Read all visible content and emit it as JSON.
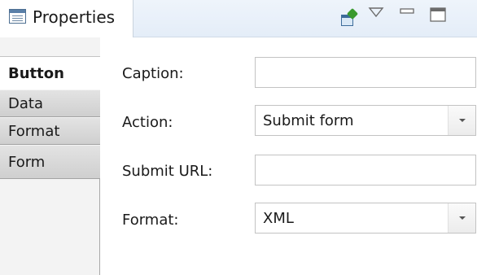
{
  "view": {
    "title": "Properties",
    "icon": "properties-view-icon",
    "toolbar": [
      "pin-editor-icon",
      "view-menu-icon",
      "minimize-icon",
      "maximize-icon"
    ]
  },
  "tabs": [
    {
      "label": "Button",
      "active": true
    },
    {
      "label": "Data",
      "active": false
    },
    {
      "label": "Format",
      "active": false
    },
    {
      "label": "Form",
      "active": false
    }
  ],
  "form": {
    "caption": {
      "label": "Caption:",
      "value": ""
    },
    "action": {
      "label": "Action:",
      "value": "Submit form"
    },
    "submit_url": {
      "label": "Submit URL:",
      "value": ""
    },
    "format": {
      "label": "Format:",
      "value": "XML"
    }
  },
  "colors": {
    "tab_bar": "#e4edf8",
    "active_tab": "#ffffff",
    "inactive_tab": "#d9d9d9",
    "field_border": "#c3c3c3"
  }
}
